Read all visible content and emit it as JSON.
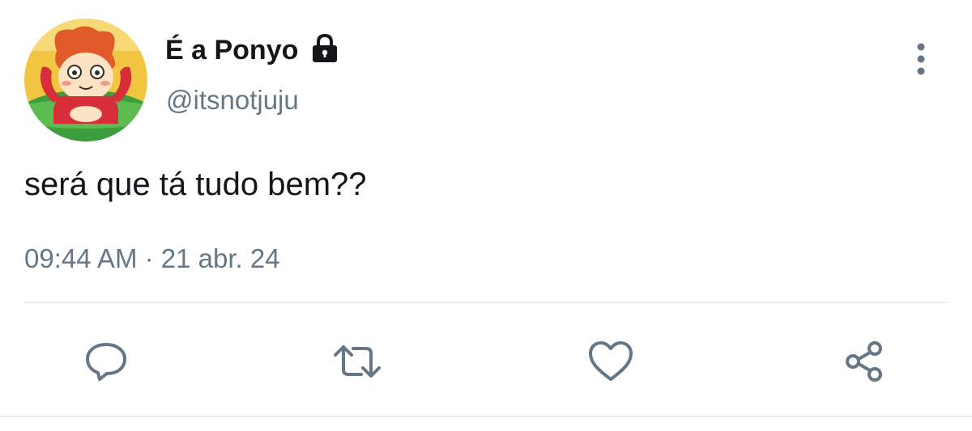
{
  "tweet": {
    "display_name": "É a Ponyo",
    "handle": "@itsnotjuju",
    "text": "será que tá tudo bem??",
    "timestamp": "09:44 AM",
    "separator": " · ",
    "date": "21 abr. 24",
    "protected": true
  },
  "icons": {
    "lock": "lock-icon",
    "more": "more-vertical-icon",
    "reply": "reply-bubble-icon",
    "retweet": "retweet-icon",
    "like": "heart-icon",
    "share": "share-icon"
  },
  "colors": {
    "primary_text": "#14171a",
    "secondary_text": "#657786",
    "divider": "#e6ecf0",
    "action_icon": "#657786"
  }
}
